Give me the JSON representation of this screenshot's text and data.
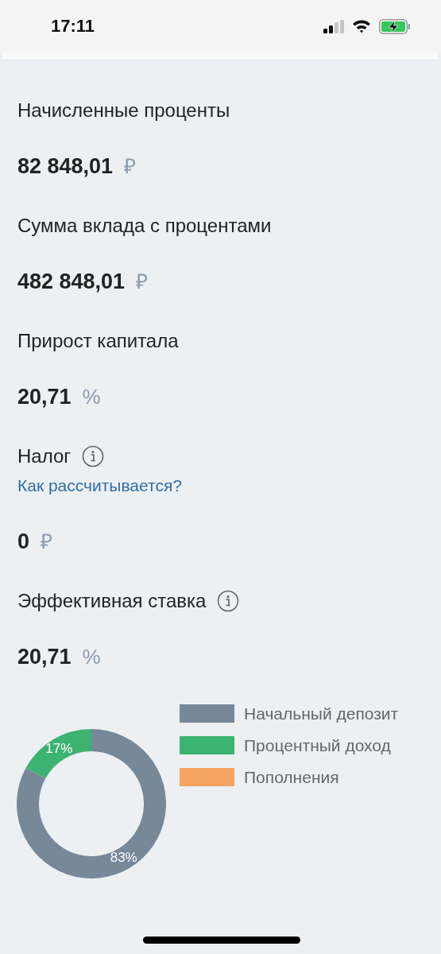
{
  "status_bar": {
    "time": "17:11"
  },
  "results": [
    {
      "label": "Начисленные проценты",
      "value": "82 848,01",
      "unit": "₽",
      "info": false
    },
    {
      "label": "Сумма вклада с процентами",
      "value": "482 848,01",
      "unit": "₽",
      "info": false
    },
    {
      "label": "Прирост капитала",
      "value": "20,71",
      "unit": "%",
      "info": false
    },
    {
      "label": "Налог",
      "value": "0",
      "unit": "₽",
      "info": true,
      "link": "Как рассчитывается?"
    },
    {
      "label": "Эффективная ставка",
      "value": "20,71",
      "unit": "%",
      "info": true
    }
  ],
  "chart_data": {
    "type": "donut",
    "categories": [
      "Начальный депозит",
      "Процентный доход",
      "Пополнения"
    ],
    "values": [
      83,
      17,
      0
    ],
    "colors": [
      "#778899",
      "#3cb371",
      "#f4a460"
    ],
    "legend": "right",
    "value_labels": [
      "83%",
      "17%",
      null
    ]
  }
}
